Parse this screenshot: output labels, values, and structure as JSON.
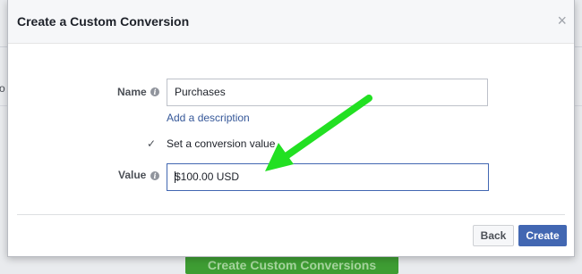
{
  "background": {
    "partial_char": "o",
    "cta_label": "Create Custom Conversions"
  },
  "modal": {
    "title": "Create a Custom Conversion",
    "close_symbol": "×"
  },
  "form": {
    "name_label": "Name",
    "name_value": "Purchases",
    "add_description_link": "Add a description",
    "set_value_checked": true,
    "set_value_label": "Set a conversion value",
    "value_label": "Value",
    "value_text": "$100.00 USD"
  },
  "footer": {
    "back_label": "Back",
    "create_label": "Create"
  },
  "colors": {
    "primary": "#4267b2",
    "link": "#365899",
    "annotation_arrow": "#22e022",
    "cta_green": "#3e9d33"
  },
  "icons": {
    "info": "info-icon",
    "checkmark": "check-icon",
    "close": "close-icon",
    "annotation": "arrow-annotation"
  }
}
